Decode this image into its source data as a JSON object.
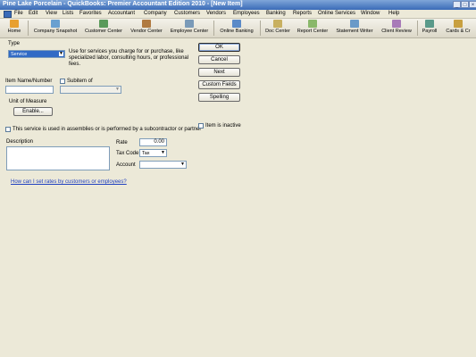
{
  "window": {
    "title": "Pine Lake Porcelain - QuickBooks: Premier Accountant Edition 2010 - [New Item]",
    "controls": [
      "_",
      "□",
      "×"
    ]
  },
  "menu": [
    "File",
    "Edit",
    "View",
    "Lists",
    "Favorites",
    "Accountant",
    "Company",
    "Customers",
    "Vendors",
    "Employees",
    "Banking",
    "Reports",
    "Online Services",
    "Window",
    "Help"
  ],
  "toolbar": [
    {
      "label": "Home",
      "icon": "home-icon",
      "color": "#e8a030"
    },
    {
      "label": "Company Snapshot",
      "icon": "snapshot-icon",
      "color": "#6aa0d0"
    },
    {
      "label": "Customer Center",
      "icon": "customer-icon",
      "color": "#5a9a5a"
    },
    {
      "label": "Vendor Center",
      "icon": "vendor-icon",
      "color": "#b07a40"
    },
    {
      "label": "Employee Center",
      "icon": "employee-icon",
      "color": "#7a9ab8"
    },
    {
      "label": "Online Banking",
      "icon": "banking-icon",
      "color": "#5a8ac8"
    },
    {
      "label": "Doc Center",
      "icon": "doc-icon",
      "color": "#c8b060"
    },
    {
      "label": "Report Center",
      "icon": "report-icon",
      "color": "#8ab86a"
    },
    {
      "label": "Statement Writer",
      "icon": "statement-icon",
      "color": "#6a9ac8"
    },
    {
      "label": "Client Review",
      "icon": "review-icon",
      "color": "#a87ab8"
    },
    {
      "label": "Payroll",
      "icon": "payroll-icon",
      "color": "#5a9a8a"
    },
    {
      "label": "Cards & Cr",
      "icon": "cards-icon",
      "color": "#c8a040"
    }
  ],
  "form": {
    "type_label": "Type",
    "type_value": "Service",
    "type_description": "Use for services you charge for or purchase, like specialized labor, consulting hours, or professional fees.",
    "item_name_label": "Item Name/Number",
    "item_name_value": "",
    "subitem_label": "Subitem of",
    "subitem_value": "",
    "uom_label": "Unit of Measure",
    "enable_button": "Enable...",
    "subcontractor_label": "This service is used in assemblies or is performed by a subcontractor or partner",
    "description_label": "Description",
    "description_value": "",
    "rate_label": "Rate",
    "rate_value": "0.00",
    "taxcode_label": "Tax Code",
    "taxcode_value": "Tax",
    "account_label": "Account",
    "account_value": "",
    "inactive_label": "Item is inactive",
    "help_link": "How can I set rates by customers or employees?"
  },
  "buttons": {
    "ok": "OK",
    "cancel": "Cancel",
    "next": "Next",
    "custom_fields": "Custom Fields",
    "spelling": "Spelling"
  }
}
